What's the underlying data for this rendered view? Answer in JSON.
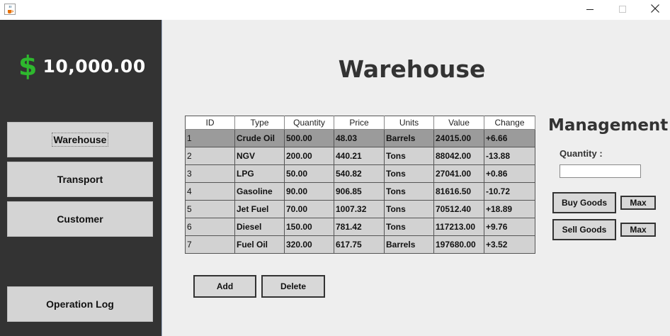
{
  "window": {
    "app_icon": "java-cup-icon",
    "controls": [
      "minimize-icon",
      "maximize-icon",
      "close-icon"
    ]
  },
  "sidebar": {
    "balance": {
      "currency_symbol": "$",
      "amount": "10,000.00"
    },
    "nav": [
      {
        "label": "Warehouse",
        "active": true
      },
      {
        "label": "Transport",
        "active": false
      },
      {
        "label": "Customer",
        "active": false
      }
    ],
    "operation_log_label": "Operation Log"
  },
  "main": {
    "title": "Warehouse",
    "table": {
      "columns": [
        "ID",
        "Type",
        "Quantity",
        "Price",
        "Units",
        "Value",
        "Change"
      ],
      "rows": [
        [
          "1",
          "Crude Oil",
          "500.00",
          "48.03",
          "Barrels",
          "24015.00",
          "+6.66"
        ],
        [
          "2",
          "NGV",
          "200.00",
          "440.21",
          "Tons",
          "88042.00",
          "-13.88"
        ],
        [
          "3",
          "LPG",
          "50.00",
          "540.82",
          "Tons",
          "27041.00",
          "+0.86"
        ],
        [
          "4",
          "Gasoline",
          "90.00",
          "906.85",
          "Tons",
          "81616.50",
          "-10.72"
        ],
        [
          "5",
          "Jet Fuel",
          "70.00",
          "1007.32",
          "Tons",
          "70512.40",
          "+18.89"
        ],
        [
          "6",
          "Diesel",
          "150.00",
          "781.42",
          "Tons",
          "117213.00",
          "+9.76"
        ],
        [
          "7",
          "Fuel Oil",
          "320.00",
          "617.75",
          "Barrels",
          "197680.00",
          "+3.52"
        ]
      ],
      "selected_row": 1
    },
    "add_label": "Add",
    "delete_label": "Delete"
  },
  "management": {
    "title": "Management",
    "quantity_label": "Quantity :",
    "quantity_value": "",
    "buy_label": "Buy Goods",
    "sell_label": "Sell Goods",
    "max_label": "Max"
  },
  "colors": {
    "sidebar_bg": "#333333",
    "main_bg": "#eeeeee",
    "dollar_green": "#2eb82e",
    "selected_row": "#9b9b9b",
    "row_bg": "#d2d2d2"
  }
}
